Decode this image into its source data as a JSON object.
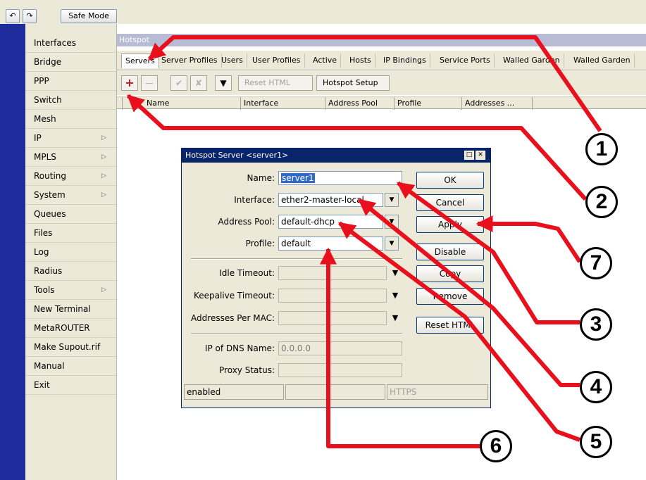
{
  "toolbar": {
    "undo_icon": "undo-icon",
    "redo_icon": "redo-icon",
    "safe_mode": "Safe Mode"
  },
  "sidebar": {
    "items": [
      {
        "label": "Interfaces",
        "submenu": false
      },
      {
        "label": "Bridge",
        "submenu": false
      },
      {
        "label": "PPP",
        "submenu": false
      },
      {
        "label": "Switch",
        "submenu": false
      },
      {
        "label": "Mesh",
        "submenu": false
      },
      {
        "label": "IP",
        "submenu": true
      },
      {
        "label": "MPLS",
        "submenu": true
      },
      {
        "label": "Routing",
        "submenu": true
      },
      {
        "label": "System",
        "submenu": true
      },
      {
        "label": "Queues",
        "submenu": false
      },
      {
        "label": "Files",
        "submenu": false
      },
      {
        "label": "Log",
        "submenu": false
      },
      {
        "label": "Radius",
        "submenu": false
      },
      {
        "label": "Tools",
        "submenu": true
      },
      {
        "label": "New Terminal",
        "submenu": false
      },
      {
        "label": "MetaROUTER",
        "submenu": false
      },
      {
        "label": "Make Supout.rif",
        "submenu": false
      },
      {
        "label": "Manual",
        "submenu": false
      },
      {
        "label": "Exit",
        "submenu": false
      }
    ]
  },
  "hotspot": {
    "title": "Hotspot",
    "tabs": [
      "Servers",
      "Server Profiles",
      "Users",
      "User Profiles",
      "Active",
      "Hosts",
      "IP Bindings",
      "Service Ports",
      "Walled Garden",
      "Walled Garden"
    ],
    "active_tab": "Servers",
    "buttons": {
      "reset_html": "Reset HTML",
      "hotspot_setup": "Hotspot Setup"
    },
    "columns": [
      "Name",
      "Interface",
      "Address Pool",
      "Profile",
      "Addresses ..."
    ]
  },
  "dialog": {
    "title": "Hotspot Server <server1>",
    "fields": {
      "name": {
        "label": "Name:",
        "value": "server1"
      },
      "interface": {
        "label": "Interface:",
        "value": "ether2-master-local"
      },
      "address_pool": {
        "label": "Address Pool:",
        "value": "default-dhcp"
      },
      "profile": {
        "label": "Profile:",
        "value": "default"
      },
      "idle_timeout": {
        "label": "Idle Timeout:",
        "value": ""
      },
      "keepalive_timeout": {
        "label": "Keepalive Timeout:",
        "value": ""
      },
      "addresses_per_mac": {
        "label": "Addresses Per MAC:",
        "value": ""
      },
      "ip_of_dns_name": {
        "label": "IP of DNS Name:",
        "value": "0.0.0.0"
      },
      "proxy_status": {
        "label": "Proxy Status:",
        "value": ""
      }
    },
    "buttons": [
      "OK",
      "Cancel",
      "Apply",
      "Disable",
      "Copy",
      "Remove",
      "Reset HTML"
    ],
    "status": {
      "left": "enabled",
      "middle": "",
      "right": "HTTPS"
    }
  },
  "callouts": [
    "1",
    "2",
    "3",
    "4",
    "5",
    "6",
    "7"
  ],
  "colors": {
    "annotation_red": "#e8101c",
    "title_blue": "#0a246a",
    "sidebar_strip": "#1f2d9c"
  }
}
